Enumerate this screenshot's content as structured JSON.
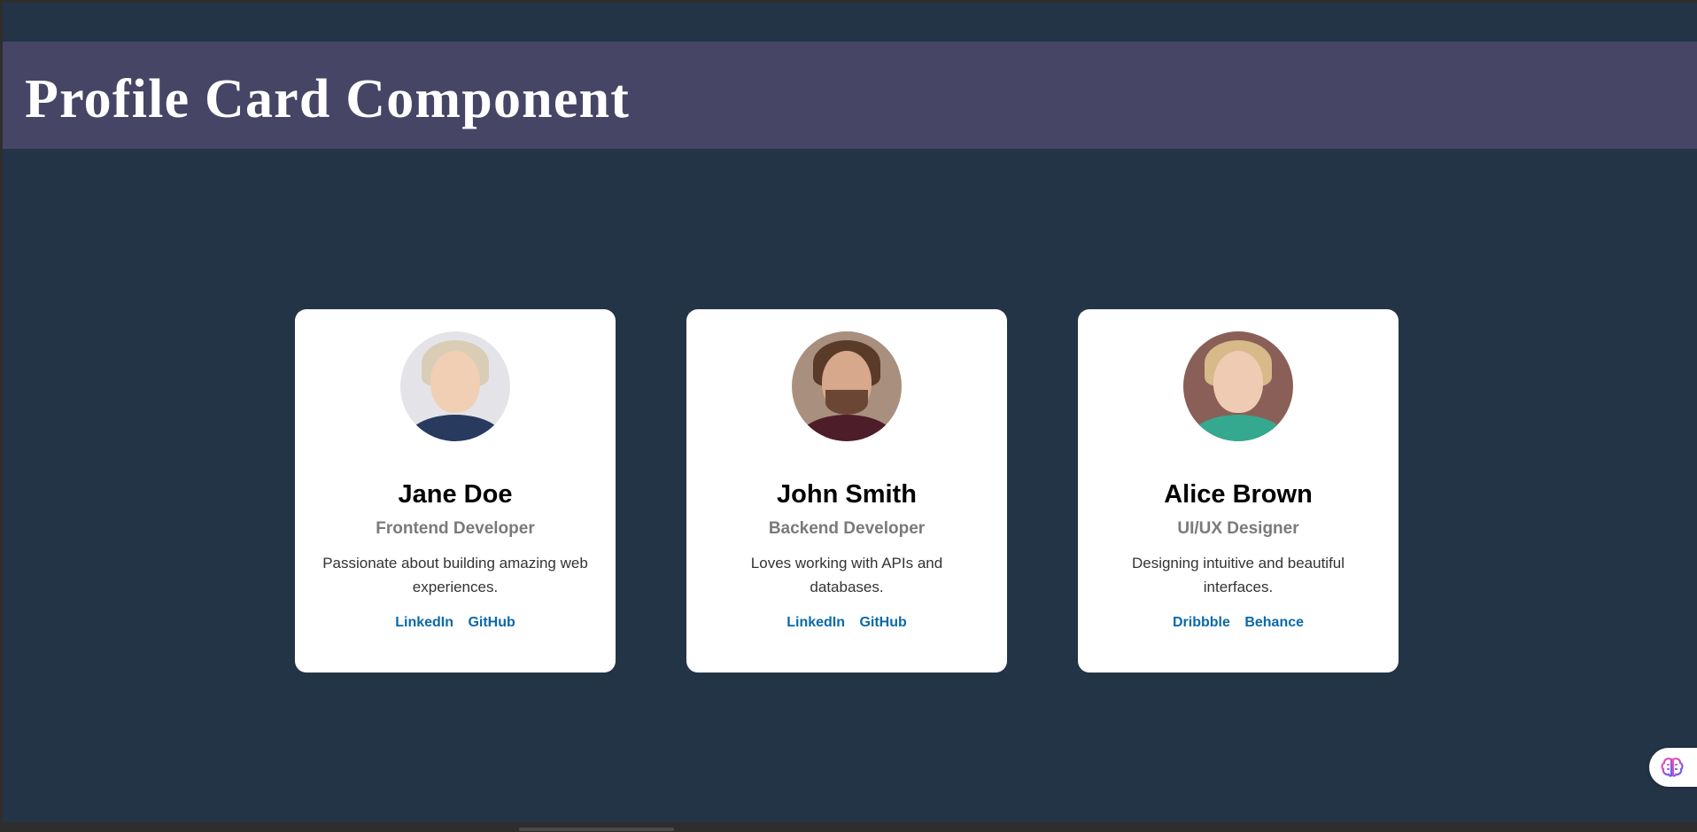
{
  "header": {
    "title": "Profile Card Component"
  },
  "cards": [
    {
      "name": "Jane Doe",
      "role": "Frontend Developer",
      "bio": "Passionate about building amazing web experiences.",
      "links": [
        "LinkedIn",
        "GitHub"
      ]
    },
    {
      "name": "John Smith",
      "role": "Backend Developer",
      "bio": "Loves working with APIs and databases.",
      "links": [
        "LinkedIn",
        "GitHub"
      ]
    },
    {
      "name": "Alice Brown",
      "role": "UI/UX Designer",
      "bio": "Designing intuitive and beautiful interfaces.",
      "links": [
        "Dribbble",
        "Behance"
      ]
    }
  ],
  "colors": {
    "page_background": "#243447",
    "header_background": "#474566",
    "card_background": "#ffffff",
    "link_color": "#0a6aa8",
    "role_color": "#7a7a7a"
  },
  "icons": {
    "assistant": "brain-icon"
  }
}
